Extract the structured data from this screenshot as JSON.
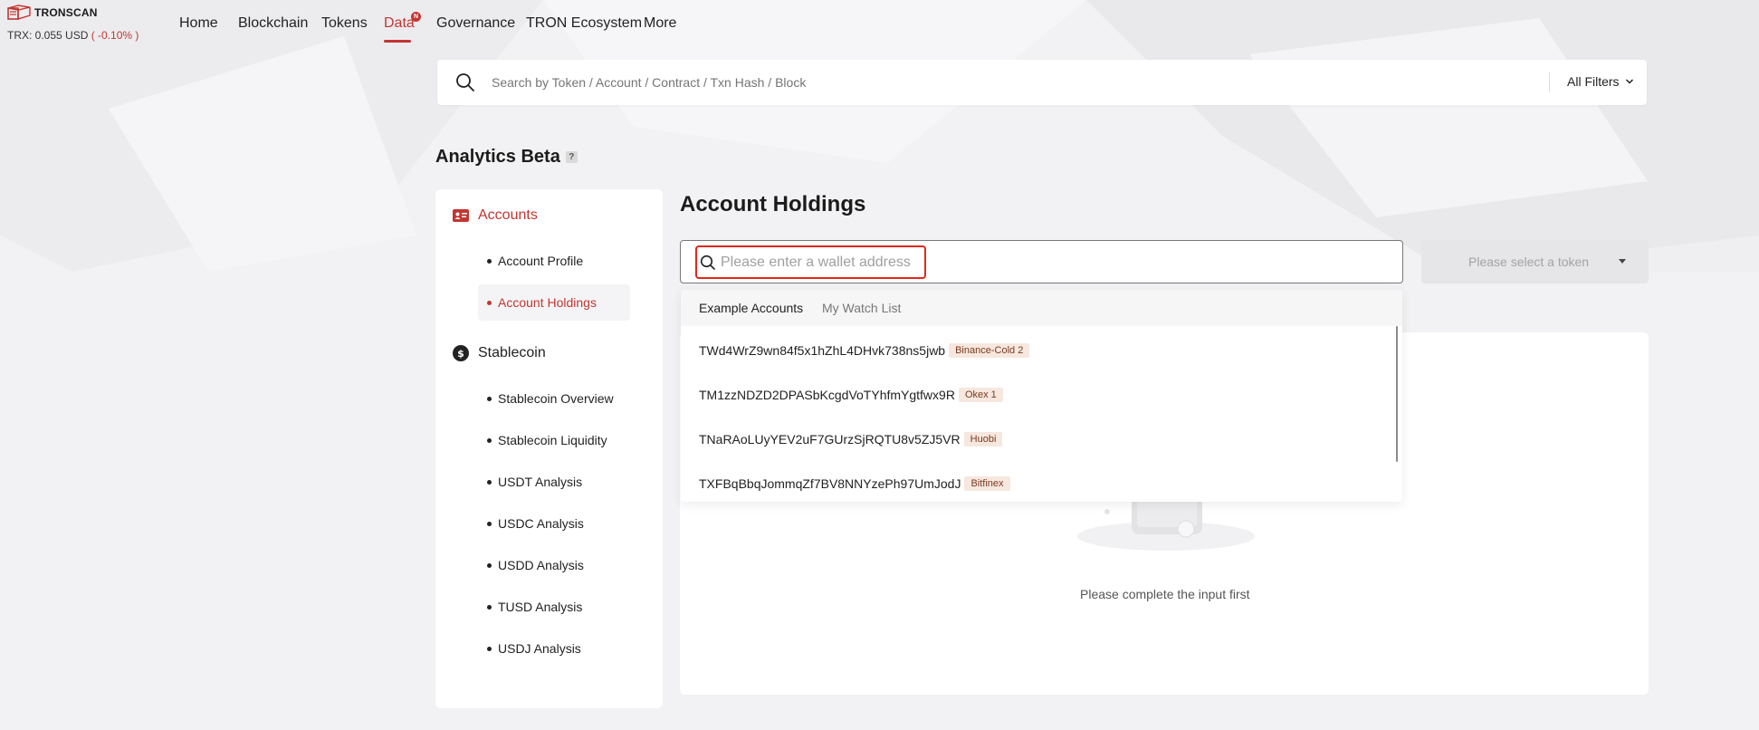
{
  "header": {
    "logo_text": "TRONSCAN",
    "price_label": "TRX: 0.055 USD",
    "price_change": "( -0.10% )",
    "nav": [
      {
        "label": "Home"
      },
      {
        "label": "Blockchain"
      },
      {
        "label": "Tokens"
      },
      {
        "label": "Data",
        "active": true,
        "badge": "N"
      },
      {
        "label": "Governance"
      },
      {
        "label": "TRON Ecosystem"
      },
      {
        "label": "More"
      }
    ]
  },
  "search": {
    "placeholder": "Search by Token / Account / Contract / Txn Hash / Block",
    "filters_label": "All Filters"
  },
  "page": {
    "title": "Analytics Beta",
    "help": "?"
  },
  "sidebar": {
    "sections": [
      {
        "label": "Accounts",
        "icon": "id-card-icon",
        "items": [
          {
            "label": "Account Profile"
          },
          {
            "label": "Account Holdings",
            "active": true
          }
        ]
      },
      {
        "label": "Stablecoin",
        "icon": "dollar-icon",
        "items": [
          {
            "label": "Stablecoin Overview"
          },
          {
            "label": "Stablecoin Liquidity"
          },
          {
            "label": "USDT Analysis"
          },
          {
            "label": "USDC Analysis"
          },
          {
            "label": "USDD Analysis"
          },
          {
            "label": "TUSD Analysis"
          },
          {
            "label": "USDJ Analysis"
          }
        ]
      }
    ]
  },
  "main": {
    "title": "Account Holdings",
    "wallet_placeholder": "Please enter a wallet address",
    "token_placeholder": "Please select a token",
    "empty_text": "Please complete the input first",
    "dropdown": {
      "tabs": [
        "Example Accounts",
        "My Watch List"
      ],
      "accounts": [
        {
          "address": "TWd4WrZ9wn84f5x1hZhL4DHvk738ns5jwb",
          "tag": "Binance-Cold 2"
        },
        {
          "address": "TM1zzNDZD2DPASbKcgdVoTYhfmYgtfwx9R",
          "tag": "Okex 1"
        },
        {
          "address": "TNaRAoLUyYEV2uF7GUrzSjRQTU8v5ZJ5VR",
          "tag": "Huobi"
        },
        {
          "address": "TXFBqBbqJommqZf7BV8NNYzePh97UmJodJ",
          "tag": "Bitfinex"
        }
      ]
    }
  },
  "colors": {
    "accent": "#c23631",
    "highlight": "#e0271c"
  }
}
